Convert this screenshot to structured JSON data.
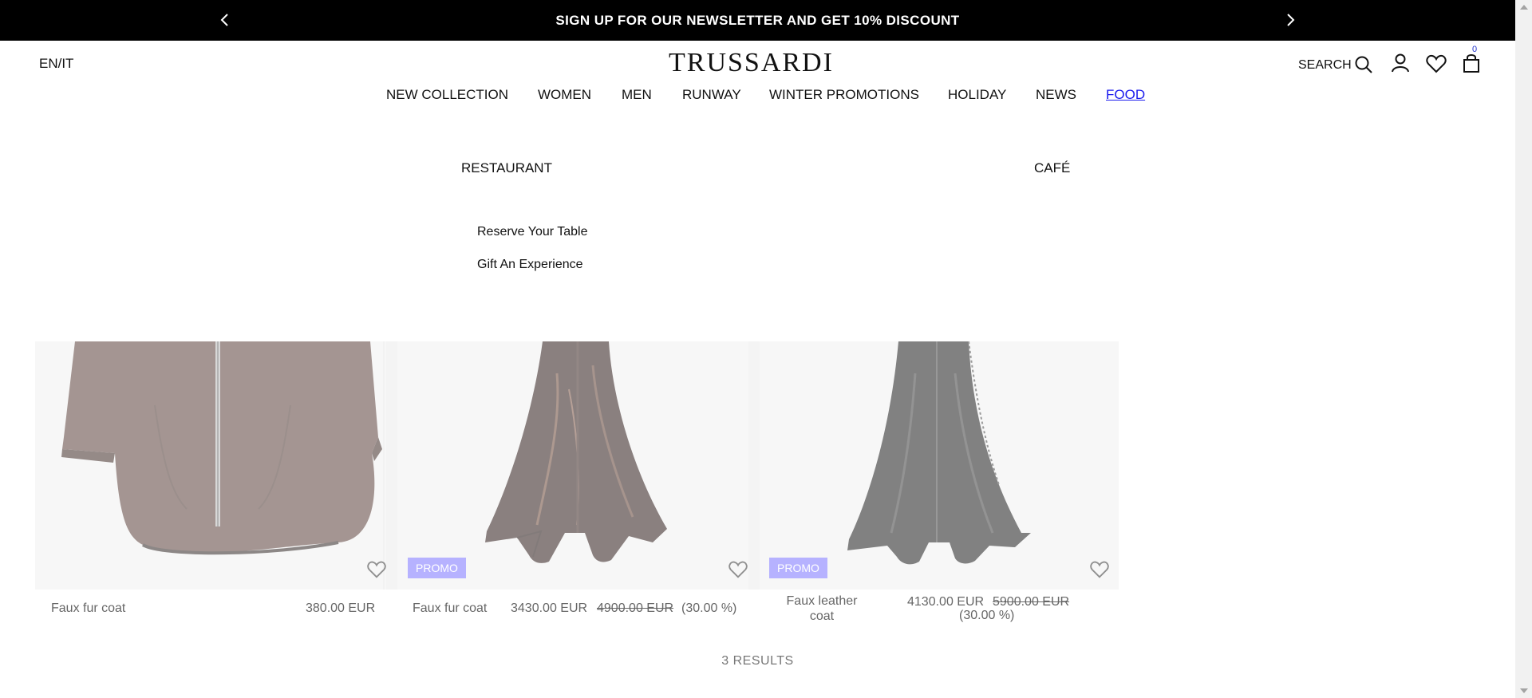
{
  "banner": {
    "text": "SIGN UP FOR OUR NEWSLETTER AND GET 10% DISCOUNT"
  },
  "header": {
    "lang": "EN/IT",
    "logo": "TRUSSARDI",
    "search_label": "SEARCH",
    "cart_count": "0"
  },
  "nav": {
    "items": [
      "NEW COLLECTION",
      "WOMEN",
      "MEN",
      "RUNWAY",
      "WINTER PROMOTIONS",
      "HOLIDAY",
      "NEWS",
      "FOOD"
    ],
    "active": "FOOD",
    "active_color": "#1a1aee"
  },
  "food_menu": {
    "restaurant": "RESTAURANT",
    "cafe": "CAFÉ",
    "links": [
      "Reserve Your Table",
      "Gift An Experience"
    ]
  },
  "products": [
    {
      "name": "Faux fur coat",
      "price": "380.00 EUR",
      "promo": "",
      "old_price": "",
      "discount": ""
    },
    {
      "name": "Faux fur coat",
      "price": "3430.00 EUR",
      "promo": "PROMO",
      "old_price": "4900.00 EUR",
      "discount": "(30.00 %)"
    },
    {
      "name": "Faux leather coat",
      "price": "4130.00 EUR",
      "promo": "PROMO",
      "old_price": "5900.00 EUR",
      "discount": "(30.00 %)"
    }
  ],
  "promo_color": "#7b73ff",
  "results": "3 RESULTS"
}
